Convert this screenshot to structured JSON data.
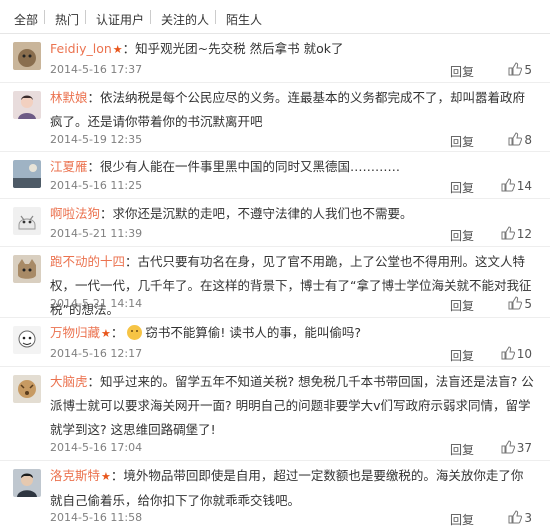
{
  "tabs": [
    {
      "label": "全部"
    },
    {
      "label": "热门"
    },
    {
      "label": "认证用户"
    },
    {
      "label": "关注的人"
    },
    {
      "label": "陌生人"
    }
  ],
  "comments": [
    {
      "user": "Feidiy_lon",
      "colon": "：",
      "text": "知乎观光团~先交税 然后拿书 就ok了",
      "time": "2014-5-16 17:37",
      "reply": "回复",
      "likes": "5",
      "badge": "★"
    },
    {
      "user": "林默娘",
      "colon": "：",
      "text": "依法纳税是每个公民应尽的义务。连最基本的义务都完成不了，却叫嚣着政府疯了。还是请你带着你的书沉默离开吧",
      "time": "2014-5-19 12:35",
      "reply": "回复",
      "likes": "8"
    },
    {
      "user": "江夏雁",
      "colon": "：",
      "text": "很少有人能在一件事里黑中国的同时又黑德国…………",
      "time": "2014-5-16 11:25",
      "reply": "回复",
      "likes": "14"
    },
    {
      "user": "啊啦法狗",
      "colon": "：",
      "text": "求你还是沉默的走吧，不遵守法律的人我们也不需要。",
      "time": "2014-5-21 11:39",
      "reply": "回复",
      "likes": "12"
    },
    {
      "user": "跑不动的十四",
      "colon": "：",
      "text": "古代只要有功名在身，见了官不用跪，上了公堂也不得用刑。这文人特权，一代一代，几千年了。在这样的背景下，博士有了“拿了博士学位海关就不能对我征税”的想法。",
      "time": "2014-5-21 14:14",
      "reply": "回复",
      "likes": "5"
    },
    {
      "user": "万物归藏",
      "colon": "：",
      "text": "窃书不能算偷! 读书人的事，能叫偷吗?",
      "time": "2014-5-16 12:17",
      "reply": "回复",
      "likes": "10",
      "badge": "★"
    },
    {
      "user": "大脑虎",
      "colon": "：",
      "text": "知乎过来的。留学五年不知道关税? 想免税几千本书带回国，法盲还是法盲? 公派博士就可以要求海关网开一面? 明明自己的问题非要学大v们写政府示弱求同情，留学就学到这? 这思维回路碉堡了!",
      "time": "2014-5-16 17:04",
      "reply": "回复",
      "likes": "37"
    },
    {
      "user": "洛克斯特",
      "colon": "：",
      "text": "境外物品带回即使是自用，超过一定数额也是要缴税的。海关放你走了你就自己偷着乐，给你扣下了你就乖乖交钱吧。",
      "time": "2014-5-16 11:58",
      "reply": "回复",
      "likes": "3",
      "badge": "★"
    }
  ]
}
